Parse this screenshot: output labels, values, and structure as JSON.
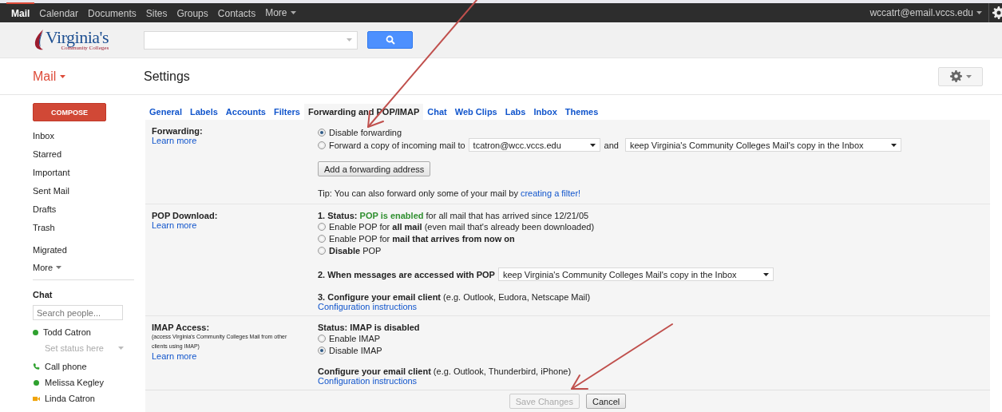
{
  "top_bar": {
    "apps": [
      {
        "label": "Mail",
        "selected": true
      },
      {
        "label": "Calendar",
        "selected": false
      },
      {
        "label": "Documents",
        "selected": false
      },
      {
        "label": "Sites",
        "selected": false
      },
      {
        "label": "Groups",
        "selected": false
      },
      {
        "label": "Contacts",
        "selected": false
      }
    ],
    "more": "More",
    "account": "wccatrt@email.vccs.edu"
  },
  "logo": {
    "title": "Virginia's",
    "subtitle": "Community Colleges"
  },
  "mail_menu": "Mail",
  "page_title": "Settings",
  "sidebar": {
    "compose": "COMPOSE",
    "items": [
      {
        "label": "Inbox",
        "kind": "system"
      },
      {
        "label": "Starred",
        "kind": "system"
      },
      {
        "label": "Important",
        "kind": "system"
      },
      {
        "label": "Sent Mail",
        "kind": "system"
      },
      {
        "label": "Drafts",
        "kind": "system"
      },
      {
        "label": "Trash",
        "kind": "system"
      },
      {
        "label": "Migrated",
        "kind": "label"
      }
    ],
    "more": "More"
  },
  "chat": {
    "title": "Chat",
    "search_placeholder": "Search people...",
    "me": {
      "name": "Todd Catron",
      "status_placeholder": "Set status here"
    },
    "contacts": [
      {
        "name": "Call phone",
        "kind": "phone"
      },
      {
        "name": "Melissa Kegley",
        "kind": "online"
      },
      {
        "name": "Linda Catron",
        "kind": "video"
      }
    ]
  },
  "tabs": [
    {
      "label": "General",
      "selected": false
    },
    {
      "label": "Labels",
      "selected": false
    },
    {
      "label": "Accounts",
      "selected": false
    },
    {
      "label": "Filters",
      "selected": false
    },
    {
      "label": "Forwarding and POP/IMAP",
      "selected": true
    },
    {
      "label": "Chat",
      "selected": false
    },
    {
      "label": "Web Clips",
      "selected": false
    },
    {
      "label": "Labs",
      "selected": false
    },
    {
      "label": "Inbox",
      "selected": false
    },
    {
      "label": "Themes",
      "selected": false
    }
  ],
  "forwarding": {
    "label": "Forwarding:",
    "learn_more": "Learn more",
    "options": [
      {
        "label": "Disable forwarding",
        "selected": true
      },
      {
        "label": "Forward a copy of incoming mail to",
        "selected": false
      }
    ],
    "address": "tcatron@wcc.vccs.edu",
    "joiner": "and",
    "action": "keep Virginia's Community Colleges Mail's copy in the Inbox",
    "add_button": "Add a forwarding address",
    "tip": "Tip: You can also forward only some of your mail by",
    "tip_link": "creating a filter!"
  },
  "pop": {
    "label": "POP Download:",
    "learn_more": "Learn more",
    "status_prefix": "1. Status:",
    "status_value": "POP is enabled",
    "status_detail": "for all mail that has arrived since 12/21/05",
    "options": [
      {
        "label": "Enable POP for **all mail** (even mail that's already been downloaded)",
        "selected": false
      },
      {
        "label": "Enable POP for **mail that arrives from now on**",
        "selected": false
      },
      {
        "label": "**Disable** POP",
        "selected": false
      }
    ],
    "access_label": "2. When messages are accessed with POP",
    "access_value": "keep Virginia's Community Colleges Mail's copy in the Inbox",
    "configure": "**3. Configure your email client** (e.g. Outlook, Eudora, Netscape Mail)",
    "instructions": "Configuration instructions"
  },
  "imap": {
    "label": "IMAP Access:",
    "note": "(access Virginia's Community Colleges Mail from other clients using IMAP)",
    "learn_more": "Learn more",
    "status": "Status: IMAP is disabled",
    "options": [
      {
        "label": "Enable IMAP",
        "selected": false
      },
      {
        "label": "Disable IMAP",
        "selected": true
      }
    ],
    "configure": "**Configure your email client** (e.g. Outlook, Thunderbird, iPhone)",
    "instructions": "Configuration instructions"
  },
  "buttons": [
    {
      "label": "Save Changes",
      "disabled": true
    },
    {
      "label": "Cancel",
      "disabled": false
    }
  ]
}
